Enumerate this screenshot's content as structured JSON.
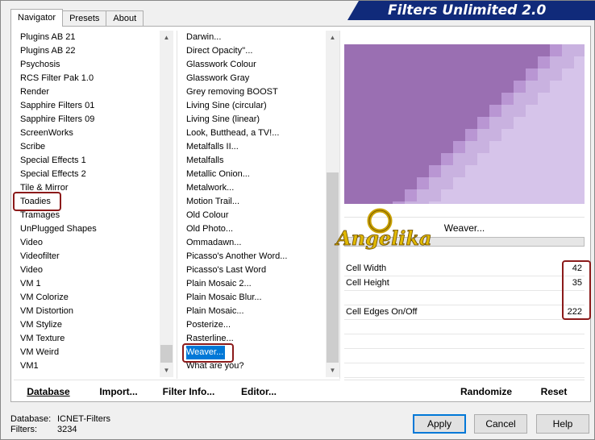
{
  "app": {
    "title": "Filters Unlimited 2.0"
  },
  "tabs": [
    {
      "label": "Navigator",
      "active": true
    },
    {
      "label": "Presets",
      "active": false
    },
    {
      "label": "About",
      "active": false
    }
  ],
  "categories": {
    "items": [
      "Plugins AB 21",
      "Plugins AB 22",
      "Psychosis",
      "RCS Filter Pak 1.0",
      "Render",
      "Sapphire Filters 01",
      "Sapphire Filters 09",
      "ScreenWorks",
      "Scribe",
      "Special Effects 1",
      "Special Effects 2",
      "Tile & Mirror",
      "Toadies",
      "Tramages",
      "UnPlugged Shapes",
      "Video",
      "Videofilter",
      "Video",
      "VM 1",
      "VM Colorize",
      "VM Distortion",
      "VM Stylize",
      "VM Texture",
      "VM Weird",
      "VM1"
    ],
    "highlighted": "Toadies"
  },
  "filters": {
    "items": [
      "Darwin...",
      "Direct Opacity''...",
      "Glasswork Colour",
      "Glasswork Gray",
      "Grey removing BOOST",
      "Living Sine (circular)",
      "Living Sine (linear)",
      "Look, Butthead, a TV!...",
      "Metalfalls II...",
      "Metalfalls",
      "Metallic Onion...",
      "Metalwork...",
      "Motion Trail...",
      "Old Colour",
      "Old Photo...",
      "Ommadawn...",
      "Picasso's Another Word...",
      "Picasso's Last Word",
      "Plain Mosaic 2...",
      "Plain Mosaic Blur...",
      "Plain Mosaic...",
      "Posterize...",
      "Rasterline...",
      "Weaver...",
      "What are you?"
    ],
    "selected": "Weaver..."
  },
  "bottom_buttons": {
    "database": "Database",
    "import": "Import...",
    "filter_info": "Filter Info...",
    "editor": "Editor...",
    "randomize": "Randomize",
    "reset": "Reset"
  },
  "preview": {
    "filter_name": "Weaver...",
    "watermark": "Angelika"
  },
  "params": [
    {
      "label": "Cell Width",
      "value": "42"
    },
    {
      "label": "Cell Height",
      "value": "35"
    },
    {
      "label": "",
      "value": ""
    },
    {
      "label": "Cell Edges On/Off",
      "value": "222"
    }
  ],
  "status": {
    "database_label": "Database:",
    "database_value": "ICNET-Filters",
    "filters_label": "Filters:",
    "filters_value": "3234"
  },
  "dialog_buttons": {
    "apply": "Apply",
    "cancel": "Cancel",
    "help": "Help"
  },
  "colors": {
    "banner": "#102a7a",
    "highlight": "#8b1a1a",
    "selection": "#0078d7",
    "preview_dark": "#9a6fb2",
    "preview_light": "#d6c4ea"
  }
}
